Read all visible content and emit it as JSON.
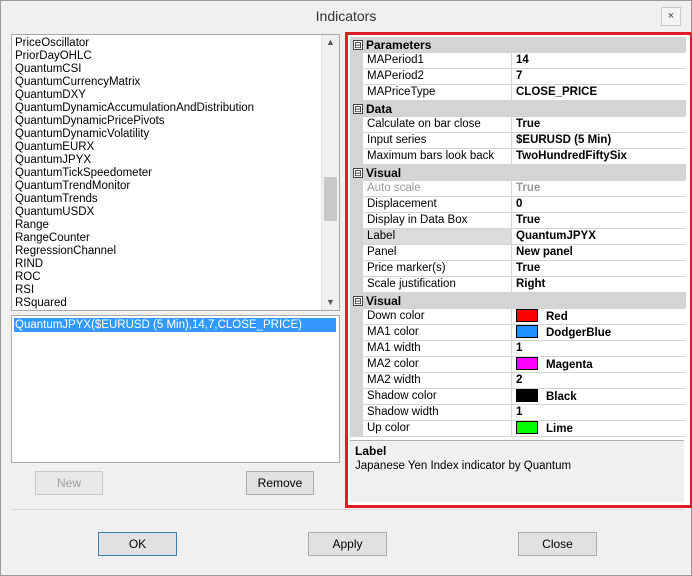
{
  "window": {
    "title": "Indicators",
    "close_glyph": "×"
  },
  "indicator_list": {
    "items": [
      "PriceOscillator",
      "PriorDayOHLC",
      "QuantumCSI",
      "QuantumCurrencyMatrix",
      "QuantumDXY",
      "QuantumDynamicAccumulationAndDistribution",
      "QuantumDynamicPricePivots",
      "QuantumDynamicVolatility",
      "QuantumEURX",
      "QuantumJPYX",
      "QuantumTickSpeedometer",
      "QuantumTrendMonitor",
      "QuantumTrends",
      "QuantumUSDX",
      "Range",
      "RangeCounter",
      "RegressionChannel",
      "RIND",
      "ROC",
      "RSI",
      "RSquared"
    ],
    "scroll_up": "▲",
    "scroll_down": "▼"
  },
  "applied": {
    "item": "QuantumJPYX($EURUSD (5 Min),14,7,CLOSE_PRICE)"
  },
  "buttons": {
    "new": "New",
    "remove": "Remove",
    "ok": "OK",
    "apply": "Apply",
    "close": "Close"
  },
  "properties": {
    "collapse_glyph": "⊟",
    "parameters": {
      "label": "Parameters",
      "rows": [
        {
          "name": "MAPeriod1",
          "value": "14"
        },
        {
          "name": "MAPeriod2",
          "value": "7"
        },
        {
          "name": "MAPriceType",
          "value": "CLOSE_PRICE"
        }
      ]
    },
    "data": {
      "label": "Data",
      "rows": [
        {
          "name": "Calculate on bar close",
          "value": "True"
        },
        {
          "name": "Input series",
          "value": "$EURUSD (5 Min)"
        },
        {
          "name": "Maximum bars look back",
          "value": "TwoHundredFiftySix"
        }
      ]
    },
    "visual": {
      "label": "Visual",
      "rows": [
        {
          "name": "Auto scale",
          "value": "True"
        },
        {
          "name": "Displacement",
          "value": "0"
        },
        {
          "name": "Display in Data Box",
          "value": "True"
        },
        {
          "name": "Label",
          "value": "QuantumJPYX"
        },
        {
          "name": "Panel",
          "value": "New panel"
        },
        {
          "name": "Price marker(s)",
          "value": "True"
        },
        {
          "name": "Scale justification",
          "value": "Right"
        }
      ]
    },
    "visual2": {
      "label": "Visual",
      "rows": [
        {
          "name": "Down color",
          "value": "Red",
          "color": "#ff0000"
        },
        {
          "name": "MA1 color",
          "value": "DodgerBlue",
          "color": "#1e90ff"
        },
        {
          "name": "MA1 width",
          "value": "1"
        },
        {
          "name": "MA2 color",
          "value": "Magenta",
          "color": "#ff00ff"
        },
        {
          "name": "MA2 width",
          "value": "2"
        },
        {
          "name": "Shadow color",
          "value": "Black",
          "color": "#000000"
        },
        {
          "name": "Shadow width",
          "value": "1"
        },
        {
          "name": "Up color",
          "value": "Lime",
          "color": "#00ff00"
        }
      ]
    },
    "help": {
      "title": "Label",
      "description": "Japanese Yen Index indicator by Quantum"
    }
  },
  "colors": {
    "highlight": "#e31c23",
    "selection": "#3399ff"
  }
}
